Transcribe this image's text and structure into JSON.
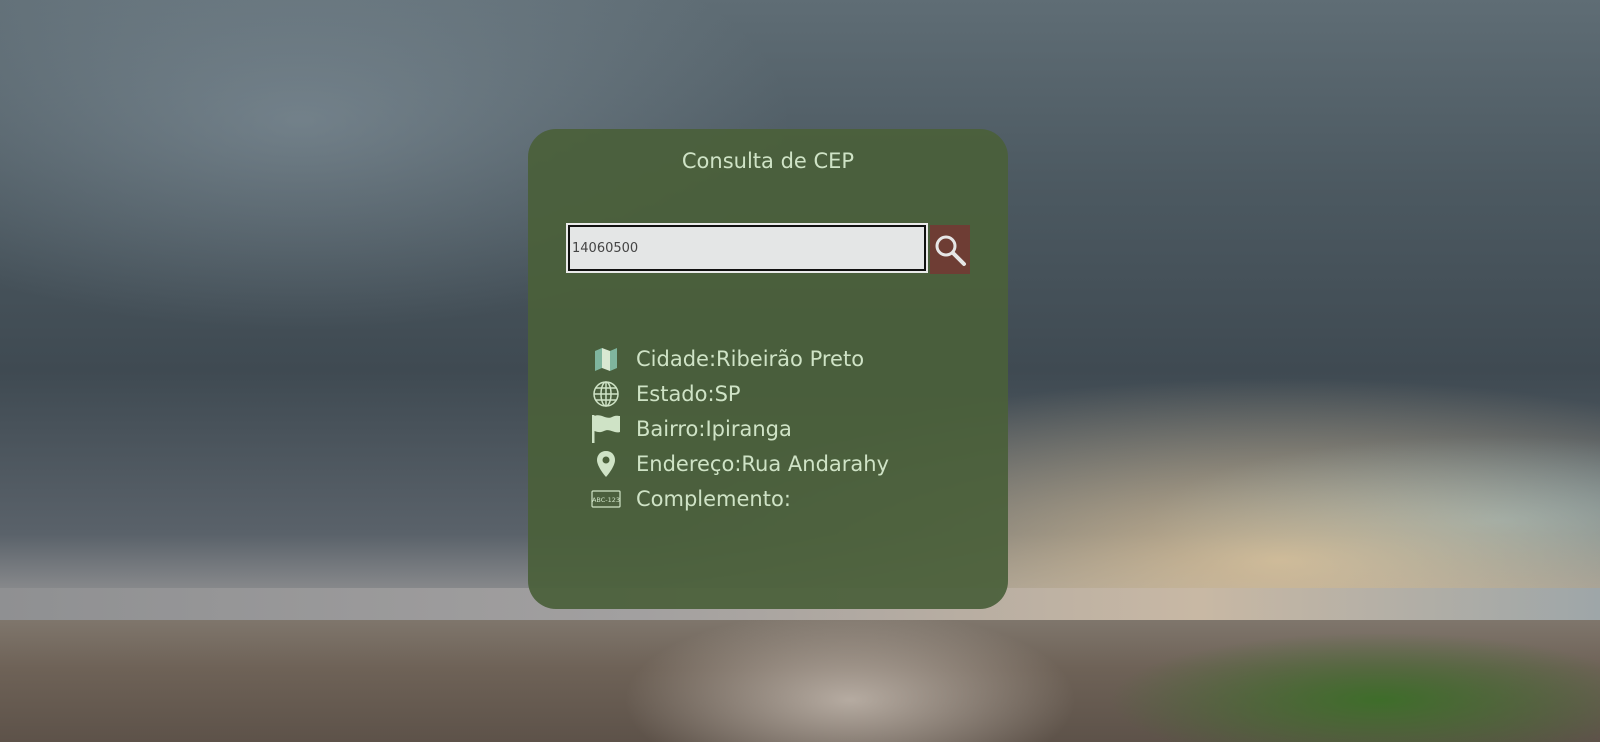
{
  "app": {
    "title": "Consulta de CEP"
  },
  "search": {
    "value": "14060500",
    "button_icon": "search-icon"
  },
  "results": [
    {
      "label": "Cidade:",
      "value": "Ribeirão Preto",
      "icon": "map-icon"
    },
    {
      "label": "Estado:",
      "value": "SP",
      "icon": "globe-icon"
    },
    {
      "label": "Bairro:",
      "value": "Ipiranga",
      "icon": "flag-icon"
    },
    {
      "label": "Endereço:",
      "value": "Rua Andarahy",
      "icon": "location-pin-icon"
    },
    {
      "label": "Complemento:",
      "value": "",
      "icon": "plate-icon"
    }
  ],
  "plate_icon_text": "ABC-123",
  "colors": {
    "card": "#4a603a",
    "text": "#cfe3c6",
    "button": "#6e3d34"
  }
}
